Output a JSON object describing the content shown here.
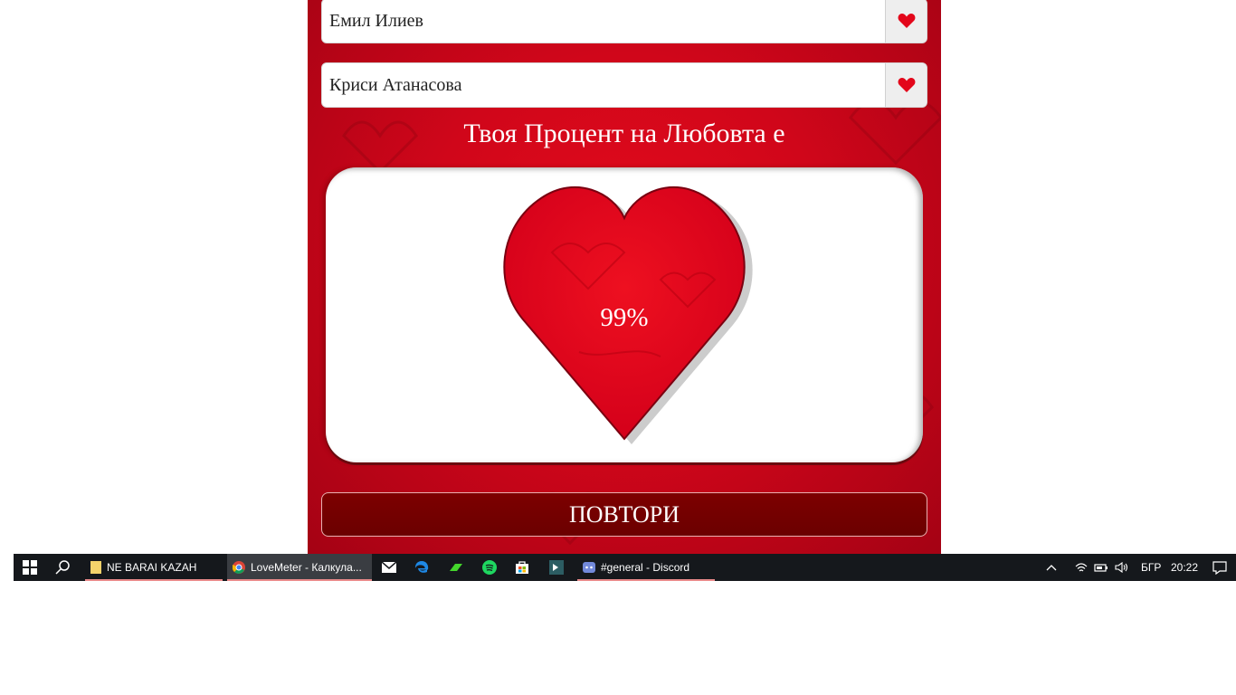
{
  "form": {
    "name1": "Емил Илиев",
    "name2": "Криси Атанасова"
  },
  "result": {
    "title": "Твоя Процент на Любовта е",
    "percent_text": "99%",
    "percent_value": 99
  },
  "actions": {
    "repeat_label": "ПОВТОРИ"
  },
  "colors": {
    "accent": "#e3061a",
    "button": "#7a0000",
    "taskbar": "#15181c"
  },
  "taskbar": {
    "tasks": [
      {
        "label": "NE BARAI KAZAH",
        "icon": "folder-icon"
      },
      {
        "label": "LoveMeter - Калкула...",
        "icon": "chrome-icon"
      },
      {
        "label": "#general - Discord",
        "icon": "discord-icon"
      }
    ],
    "pinned": [
      "mail-icon",
      "edge-icon",
      "razer-icon",
      "spotify-icon",
      "store-icon",
      "terminal-icon"
    ],
    "language": "БГР",
    "time": "20:22"
  }
}
